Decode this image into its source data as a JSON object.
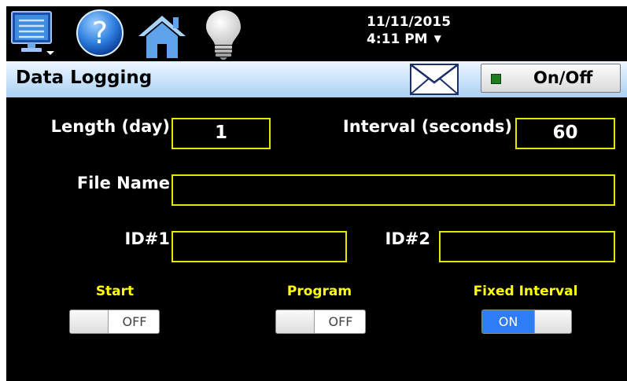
{
  "toolbar": {
    "icons": [
      "menu-icon",
      "help-icon",
      "home-icon",
      "lightbulb-icon"
    ],
    "date": "11/11/2015",
    "time": "4:11 PM",
    "time_arrow": "▼"
  },
  "header": {
    "title": "Data Logging",
    "mail_icon": "envelope-icon",
    "onoff_label": "On/Off",
    "onoff_led_color": "#1e7d1e"
  },
  "form": {
    "length_label": "Length (day)",
    "length_value": "1",
    "interval_label": "Interval (seconds)",
    "interval_value": "60",
    "filename_label": "File Name",
    "filename_value": "",
    "id1_label": "ID#1",
    "id1_value": "",
    "id2_label": "ID#2",
    "id2_value": ""
  },
  "toggles": {
    "start": {
      "label": "Start",
      "state": "OFF"
    },
    "program": {
      "label": "Program",
      "state": "OFF"
    },
    "fixed_interval": {
      "label": "Fixed Interval",
      "state": "ON"
    }
  },
  "colors": {
    "background": "#000000",
    "field_border": "#e6e600",
    "toggle_label": "#ffff00",
    "toggle_on": "#2e7cf6",
    "title_bar": "#bcdcf7"
  }
}
